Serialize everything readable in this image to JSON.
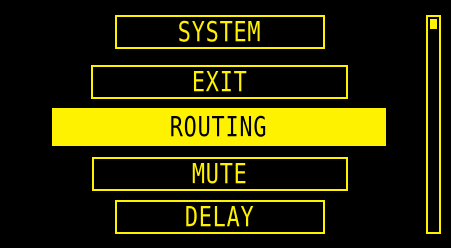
{
  "menu": {
    "items": [
      {
        "label": "SYSTEM",
        "selected": false
      },
      {
        "label": "EXIT",
        "selected": false
      },
      {
        "label": "ROUTING",
        "selected": true
      },
      {
        "label": "MUTE",
        "selected": false
      },
      {
        "label": "DELAY",
        "selected": false
      }
    ]
  },
  "scrollbar": {
    "position_fraction": 0.0
  },
  "colors": {
    "background": "#000000",
    "foreground": "#FFF200"
  }
}
